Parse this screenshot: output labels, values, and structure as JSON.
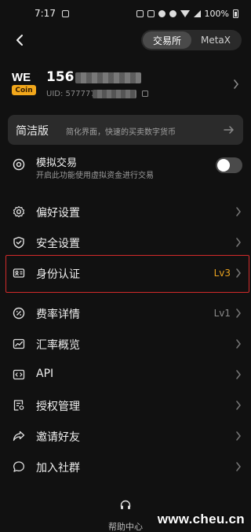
{
  "status_bar": {
    "time": "7:17",
    "battery": "100%"
  },
  "header": {
    "back_icon": "chevron-left-icon",
    "tabs": [
      {
        "label": "交易所",
        "active": true
      },
      {
        "label": "MetaX",
        "active": false
      }
    ]
  },
  "profile": {
    "logo_top": "WE",
    "logo_bottom": "Coin",
    "phone_prefix": "156",
    "uid_prefix": "UID: 577777"
  },
  "simple_mode": {
    "title": "简洁版",
    "description": "简化界面，快速的买卖数字货币"
  },
  "simulated_trading": {
    "title": "模拟交易",
    "description": "开启此功能使用虚拟资金进行交易",
    "enabled": false
  },
  "menu": [
    {
      "label": "偏好设置",
      "icon": "gear-icon",
      "value": ""
    },
    {
      "label": "安全设置",
      "icon": "shield-icon",
      "value": ""
    },
    {
      "label": "身份认证",
      "icon": "id-card-icon",
      "value": "Lv3"
    },
    {
      "label": "费率详情",
      "icon": "percent-icon",
      "value": "Lv1"
    },
    {
      "label": "汇率概览",
      "icon": "chart-icon",
      "value": ""
    },
    {
      "label": "API",
      "icon": "code-icon",
      "value": ""
    },
    {
      "label": "授权管理",
      "icon": "authorize-icon",
      "value": ""
    },
    {
      "label": "邀请好友",
      "icon": "share-icon",
      "value": ""
    },
    {
      "label": "加入社群",
      "icon": "chat-icon",
      "value": ""
    }
  ],
  "footer": {
    "help_label": "帮助中心",
    "help_icon": "headset-icon"
  },
  "watermark": "www.cheu.cn",
  "colors": {
    "background": "#111111",
    "accent_gold": "#e9a21f",
    "highlight_red": "#d22b2b"
  }
}
